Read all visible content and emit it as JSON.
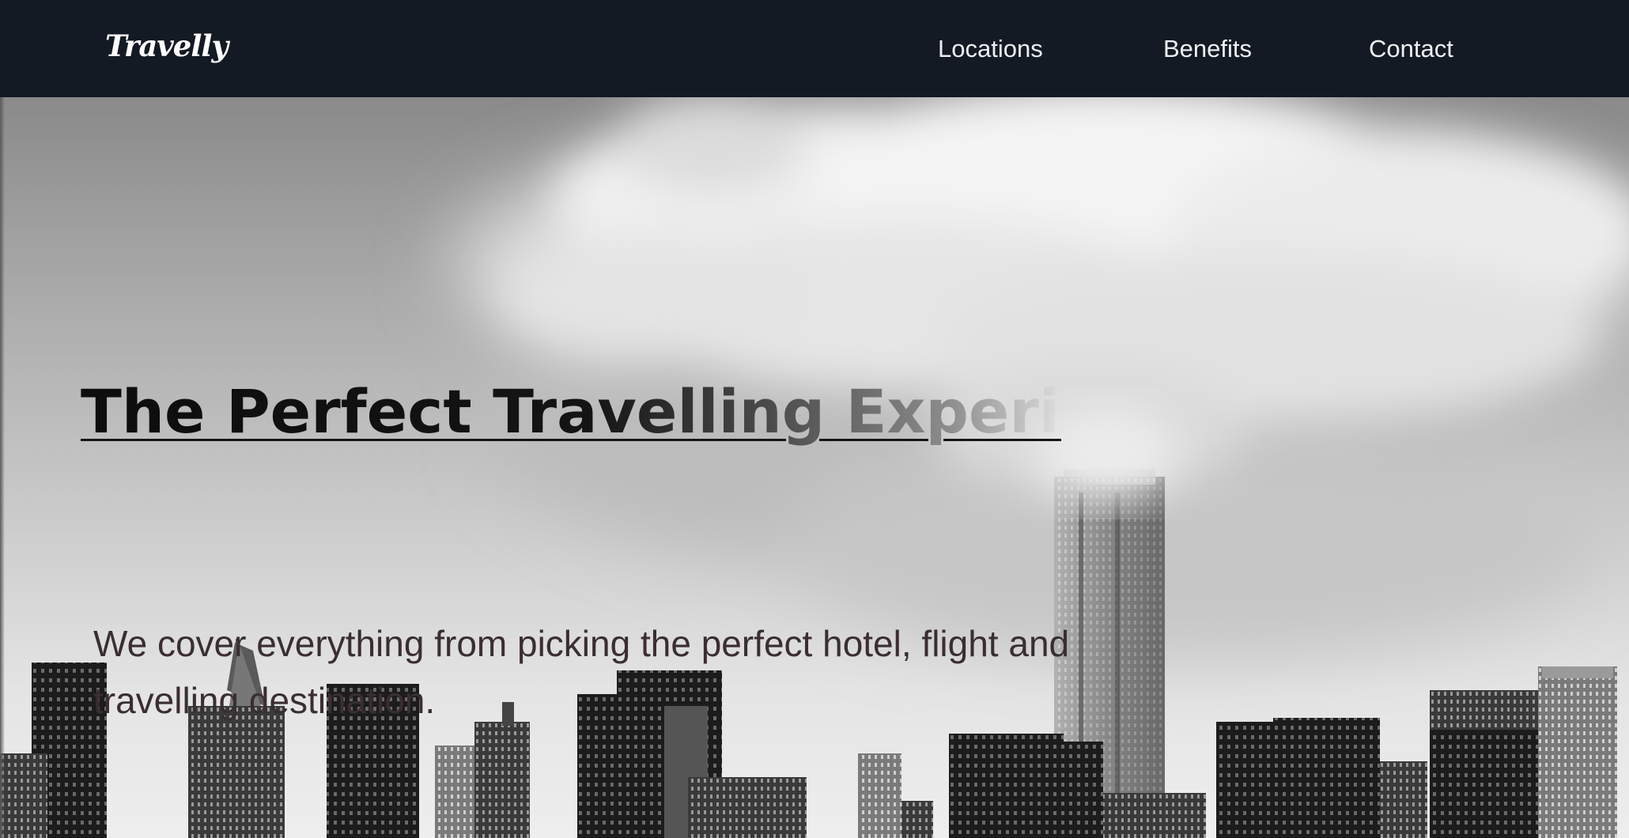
{
  "navbar": {
    "logo": "Travelly",
    "links": [
      {
        "label": "Locations"
      },
      {
        "label": "Benefits"
      },
      {
        "label": "Contact"
      }
    ]
  },
  "hero": {
    "title": "The Perfect Travelling Experience",
    "subtitle": "We cover everything from picking the perfect hotel, flight and travelling destination.",
    "background": "black-and-white city skyline with clouds"
  }
}
